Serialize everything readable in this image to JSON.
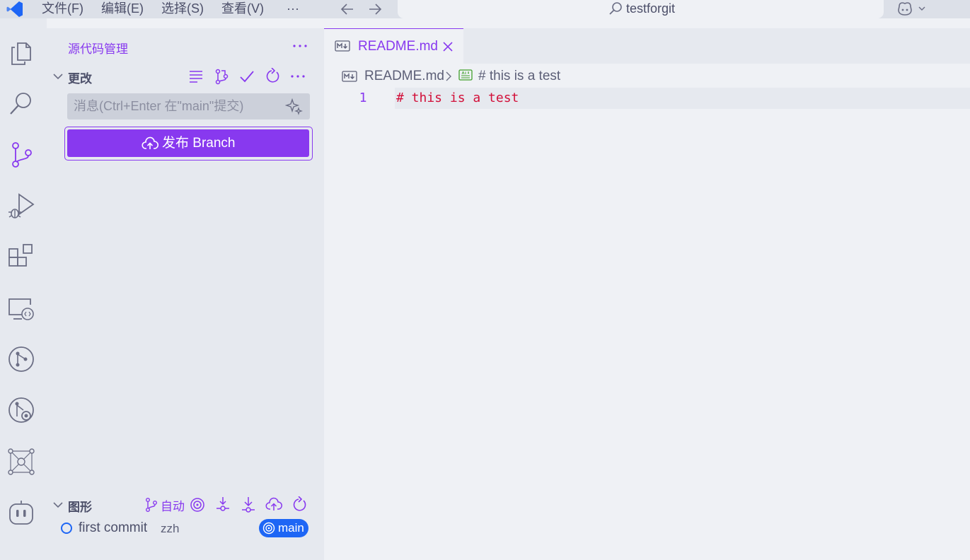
{
  "window": {
    "menu": [
      "文件(F)",
      "编辑(E)",
      "选择(S)",
      "查看(V)",
      "···"
    ],
    "search_text": "testforgit"
  },
  "activity_bar": {
    "items": [
      "explorer-icon",
      "search-icon",
      "source-control-icon",
      "run-debug-icon",
      "extensions-icon",
      "remote-explorer-icon",
      "git-icon",
      "git-graph-icon",
      "network-icon",
      "copilot-icon"
    ]
  },
  "sidebar": {
    "title": "源代码管理",
    "more": "···",
    "changes": {
      "label": "更改",
      "message_placeholder": "消息(Ctrl+Enter 在\"main\"提交)",
      "publish_label": "发布 Branch"
    },
    "graph": {
      "label": "图形",
      "auto_label": "自动",
      "commits": [
        {
          "message": "first commit",
          "author": "zzh",
          "branch": "main"
        }
      ]
    }
  },
  "editor": {
    "tab_label": "README.md",
    "breadcrumb_file": "README.md",
    "breadcrumb_symbol": "# this is a test",
    "lines": [
      {
        "number": "1",
        "text": "# this is a test"
      }
    ]
  },
  "colors": {
    "accent": "#8839ef",
    "branch_badge": "#1e66f5",
    "heading_text": "#d20f39"
  }
}
